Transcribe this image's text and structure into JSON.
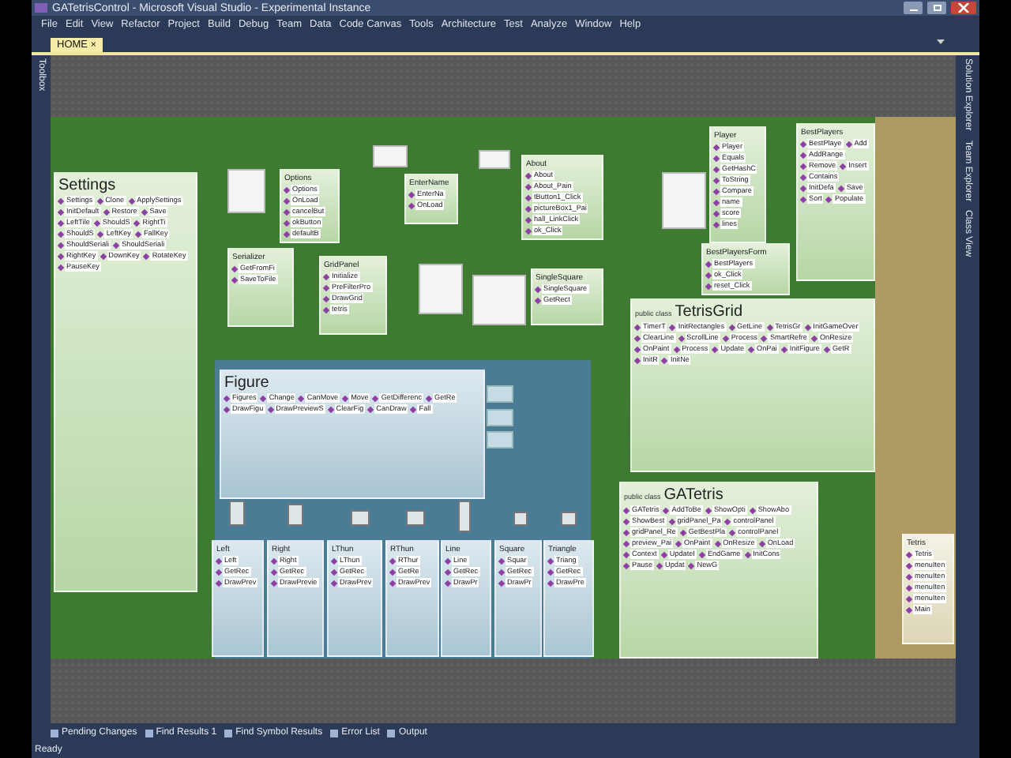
{
  "window": {
    "title": "GATetrisControl - Microsoft Visual Studio - Experimental Instance"
  },
  "menu": [
    "File",
    "Edit",
    "View",
    "Refactor",
    "Project",
    "Build",
    "Debug",
    "Team",
    "Data",
    "Code Canvas",
    "Tools",
    "Architecture",
    "Test",
    "Analyze",
    "Window",
    "Help"
  ],
  "tabs": [
    {
      "label": "HOME",
      "close": "×",
      "selected": true
    }
  ],
  "left_dock": [
    "Toolbox"
  ],
  "right_dock": [
    "Solution Explorer",
    "Team Explorer",
    "Class View"
  ],
  "canvas": {
    "nodes": [
      {
        "title": "Settings",
        "kind": "green",
        "members": [
          "Settings",
          "Clone",
          "ApplySettings",
          "InitDefault",
          "Restore",
          "Save",
          "LeftTile",
          "ShouldS",
          "RightTi",
          "ShouldS",
          "LeftKey",
          "FallKey",
          "ShouldSeriali",
          "ShouldSeriali",
          "RightKey",
          "DownKey",
          "RotateKey",
          "PauseKey"
        ]
      },
      {
        "title": "Options",
        "kind": "green",
        "members": [
          "Options",
          "OnLoad",
          "cancelBut",
          "okButton",
          "defaultB"
        ]
      },
      {
        "title": "Serializer",
        "kind": "green",
        "members": [
          "GetFromFi",
          "SaveToFile"
        ]
      },
      {
        "title": "GridPanel",
        "kind": "green",
        "members": [
          "Initialize",
          "PreFilterPro",
          "DrawGrid",
          "tetris"
        ]
      },
      {
        "title": "Figure",
        "kind": "blue",
        "members": [
          "Figures",
          "Change",
          "CanMove",
          "Move",
          "GetDifferenc",
          "GetRe",
          "DrawFigu",
          "DrawPreviewS",
          "ClearFig",
          "CanDraw",
          "Fall"
        ]
      },
      {
        "title": "Left",
        "kind": "blue",
        "members": [
          "Left",
          "GetRec",
          "DrawPrev"
        ]
      },
      {
        "title": "Right",
        "kind": "blue",
        "members": [
          "Right",
          "GetRec",
          "DrawPrevie"
        ]
      },
      {
        "title": "LThun",
        "kind": "blue",
        "members": [
          "LThun",
          "GetRec",
          "DrawPrev"
        ]
      },
      {
        "title": "RThun",
        "kind": "blue",
        "members": [
          "RThur",
          "GetRe",
          "DrawPrev"
        ]
      },
      {
        "title": "Line",
        "kind": "blue",
        "members": [
          "Line",
          "GetRec",
          "DrawPr"
        ]
      },
      {
        "title": "Square",
        "kind": "blue",
        "members": [
          "Squar",
          "GetRec",
          "DrawPr"
        ]
      },
      {
        "title": "Triangle",
        "kind": "blue",
        "members": [
          "Triang",
          "GetRec",
          "DrawPre"
        ]
      },
      {
        "title": "TetrisGrid",
        "prefix": "public class",
        "kind": "green",
        "members": [
          "TimerT",
          "InitRectangles",
          "GetLine",
          "TetrisGr",
          "InitGameOver",
          "ClearLine",
          "ScrollLine",
          "Process",
          "SmartRefre",
          "OnResize",
          "OnPaint",
          "Process",
          "Update",
          "OnPai",
          "InitFigure",
          "GetR",
          "InitR",
          "InitNe"
        ]
      },
      {
        "title": "GATetris",
        "prefix": "public class",
        "kind": "green",
        "members": [
          "GATetris",
          "AddToBe",
          "ShowOpti",
          "ShowAbo",
          "ShowBest",
          "gridPanel_Pa",
          "controlPanel",
          "gridPanel_Re",
          "GetBestPla",
          "controlPanel",
          "preview_Pai",
          "OnPaint",
          "OnResize",
          "OnLoad",
          "Context",
          "UpdateI",
          "EndGame",
          "InitCons",
          "Pause",
          "Updat",
          "NewG"
        ]
      },
      {
        "title": "About",
        "kind": "green",
        "members": [
          "About",
          "About_Pain",
          "tButton1_Click",
          "pictureBox1_Pai",
          "hall_LinkClick",
          "ok_Click"
        ]
      },
      {
        "title": "EnterName",
        "kind": "green",
        "members": [
          "EnterNa",
          "OnLoad"
        ]
      },
      {
        "title": "Player",
        "kind": "green",
        "members": [
          "Player",
          "Equals",
          "GetHashC",
          "ToString",
          "Compare",
          "name",
          "score",
          "lines"
        ]
      },
      {
        "title": "BestPlayers",
        "kind": "green",
        "members": [
          "BestPlaye",
          "Add",
          "AddRange",
          "Remove",
          "Insert",
          "Contains",
          "InitDefa",
          "Save",
          "Sort",
          "Populate"
        ]
      },
      {
        "title": "BestPlayersForm",
        "kind": "green",
        "members": [
          "BestPlayers",
          "ok_Click",
          "reset_Click"
        ]
      },
      {
        "title": "SingleSquare",
        "kind": "green",
        "members": [
          "SingleSquare",
          "GetRect"
        ]
      },
      {
        "title": "Tetris",
        "kind": "tan",
        "members": [
          "Tetris",
          "menuIten",
          "menuIten",
          "menuIten",
          "menuIten",
          "Main"
        ]
      }
    ]
  },
  "bottom_tabs": [
    "Pending Changes",
    "Find Results 1",
    "Find Symbol Results",
    "Error List",
    "Output"
  ],
  "status_bar": "Ready"
}
